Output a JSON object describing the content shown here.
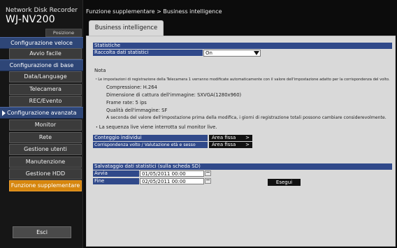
{
  "brand": {
    "line1": "Network Disk Recorder",
    "model": "WJ-NV200"
  },
  "home_link": "Posizione iniziale",
  "sidebar": {
    "sections": [
      {
        "label": "Configurazione veloce"
      },
      {
        "label": "Configurazione di base"
      },
      {
        "label": "Configurazione avanzata"
      }
    ],
    "items": [
      {
        "label": "Avvio facile"
      },
      {
        "label": "Data/Language"
      },
      {
        "label": "Telecamera"
      },
      {
        "label": "REC/Evento"
      },
      {
        "label": "Monitor"
      },
      {
        "label": "Rete"
      },
      {
        "label": "Gestione utenti"
      },
      {
        "label": "Manutenzione"
      },
      {
        "label": "Gestione HDD"
      },
      {
        "label": "Funzione supplementare"
      }
    ],
    "logout": "Esci"
  },
  "breadcrumb": "Funzione supplementare > Business intelligence",
  "tab": "Business intelligence",
  "stats": {
    "header": "Statistiche",
    "collect_label": "Raccolta dati statistici",
    "collect_value": "On"
  },
  "note": {
    "title": "Nota",
    "l1": "・Le impostazioni di registrazione della Telecamera 1 verranno modificate automaticamente con il valore dell'impostazione adatto per la corrispondenza del volto.",
    "l2": "Compressione: H.264",
    "l3": "Dimensione di cattura dell'immagine: SXVGA(1280x960)",
    "l4": "Frame rate: 5 ips",
    "l5": "Qualità dell'immagine: SF",
    "l6": "A seconda del valore dell'impostazione prima della modifica, i giorni di registrazione totali possono cambiare considerevolmente.",
    "l7": "・La sequenza live viene interrotta sul monitor live."
  },
  "people_count": {
    "label": "Conteggio individui",
    "button": "Area fissa"
  },
  "face_match": {
    "label": "Corrispondenza volto / Valutazione età e sesso",
    "button": "Area fissa"
  },
  "save": {
    "header": "Salvataggio dati statistici (sulla scheda SD)",
    "start_label": "Avvia",
    "start_value": "01/05/2011 00:00",
    "end_label": "Fine",
    "end_value": "02/05/2011 00:00",
    "execute": "Esegui"
  },
  "colors": {
    "accent": "#30498a",
    "active": "#d6860d",
    "panel": "#d9d9d9"
  }
}
